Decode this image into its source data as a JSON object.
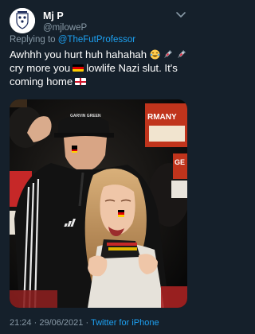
{
  "author": {
    "display_name": "Mj P",
    "handle": "@mjloweP"
  },
  "reply": {
    "prefix": "Replying to",
    "mention": "@TheFutProfessor"
  },
  "tweet": {
    "line1": "Awhhh you hurt huh hahahah",
    "line2_a": "cry more you",
    "line2_b": "lowlife Nazi slut. It's",
    "line3": "coming home"
  },
  "media": {
    "cap_text": "GARVIN GREEN",
    "banner_text": "RMANY",
    "side_text": "GE"
  },
  "meta": {
    "time": "21:24",
    "separator": "·",
    "date": "29/06/2021",
    "source": "Twitter for iPhone"
  },
  "colors": {
    "background": "#15202b",
    "secondary_text": "#8899a6",
    "link": "#1da1f2"
  },
  "icons": [
    "avatar-badge-icon",
    "more-options-icon",
    "laughing-emoji-icon",
    "syringe-emoji-icon",
    "germany-flag-icon",
    "england-flag-icon"
  ]
}
